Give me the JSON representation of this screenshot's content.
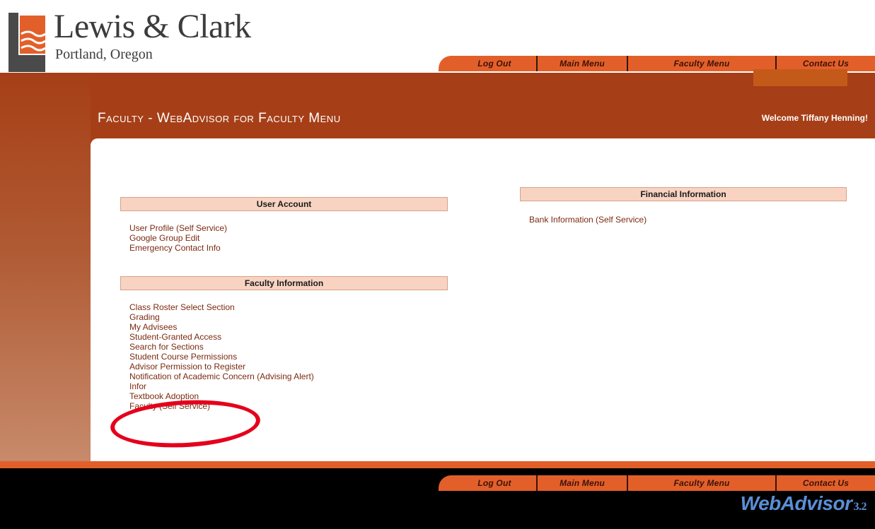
{
  "brand": {
    "name": "Lewis & Clark",
    "location": "Portland, Oregon",
    "colors": {
      "orange": "#e35f2a",
      "rust": "#a63f17",
      "link": "#7a2a10",
      "section_bg": "#f8d3c2",
      "annotation_red": "#e5001c"
    }
  },
  "nav": {
    "logout": "Log Out",
    "main_menu": "Main Menu",
    "faculty_menu": "Faculty Menu",
    "contact_us": "Contact Us"
  },
  "page": {
    "title": "Faculty - WebAdvisor for Faculty Menu",
    "welcome": "Welcome Tiffany Henning!"
  },
  "sections": {
    "user_account": {
      "title": "User Account",
      "links": [
        "User Profile (Self Service)",
        "Google Group Edit",
        "Emergency Contact Info"
      ]
    },
    "faculty_information": {
      "title": "Faculty Information",
      "links": [
        "Class Roster Select Section",
        "Grading",
        "My Advisees",
        "Student-Granted Access",
        "Search for Sections",
        "Student Course Permissions",
        "Advisor Permission to Register",
        "Notification of Academic Concern (Advising Alert)",
        "Infor",
        "Textbook Adoption",
        "Faculty (Self Service)"
      ]
    },
    "financial_information": {
      "title": "Financial Information",
      "links": [
        "Bank Information (Self Service)"
      ]
    }
  },
  "footer": {
    "product": "WebAdvisor",
    "version": "3.2"
  }
}
